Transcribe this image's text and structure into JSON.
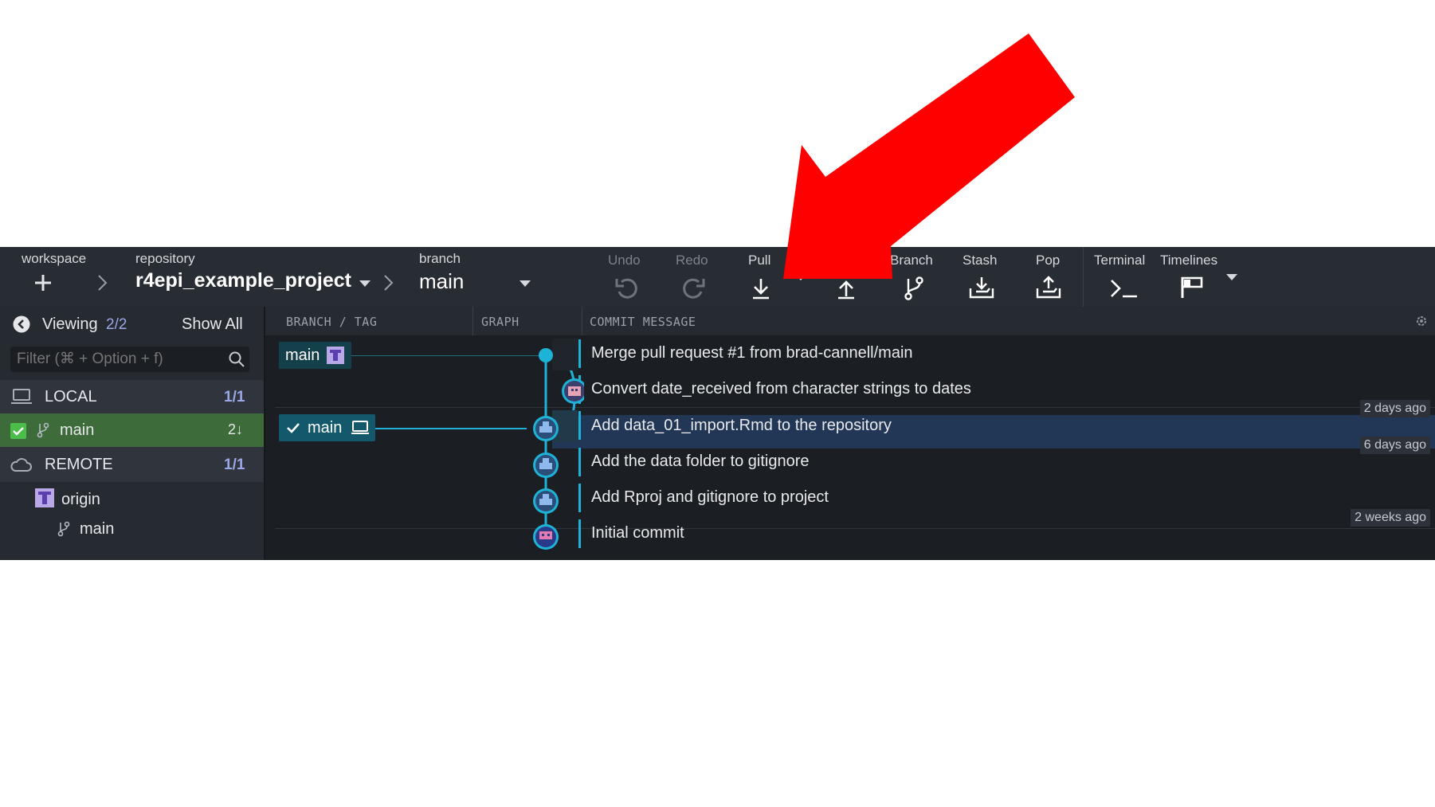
{
  "toolbar": {
    "workspace_label": "workspace",
    "repository_label": "repository",
    "repository_name": "r4epi_example_project",
    "branch_label": "branch",
    "branch_name": "main",
    "undo": "Undo",
    "redo": "Redo",
    "pull": "Pull",
    "branch": "Branch",
    "stash": "Stash",
    "pop": "Pop",
    "terminal": "Terminal",
    "timelines": "Timelines"
  },
  "sidebar": {
    "viewing_label": "Viewing",
    "viewing_count": "2/2",
    "show_all": "Show All",
    "filter_placeholder": "Filter (⌘ + Option + f)",
    "local_label": "LOCAL",
    "local_count": "1/1",
    "local_branch": "main",
    "local_branch_behind": "2↓",
    "remote_label": "REMOTE",
    "remote_count": "1/1",
    "remote_name": "origin",
    "remote_branch": "main"
  },
  "columns": {
    "branch_tag": "BRANCH / TAG",
    "graph": "GRAPH",
    "commit_message": "COMMIT MESSAGE"
  },
  "refs": {
    "remote_main": "main",
    "local_main": "main"
  },
  "commits": [
    {
      "message": "Merge pull request #1 from brad-cannell/main"
    },
    {
      "message": "Convert date_received from character strings to dates"
    },
    {
      "message": "Add data_01_import.Rmd to the repository"
    },
    {
      "message": "Add the data folder to gitignore"
    },
    {
      "message": "Add Rproj and gitignore to project"
    },
    {
      "message": "Initial commit"
    }
  ],
  "time_labels": [
    "2 days ago",
    "6 days ago",
    "2 weeks ago"
  ],
  "colors": {
    "accent": "#1eb3d6",
    "annotation_arrow": "#ff0000",
    "selected_row": "#223655",
    "local_branch_bg": "#3e6b3a"
  }
}
